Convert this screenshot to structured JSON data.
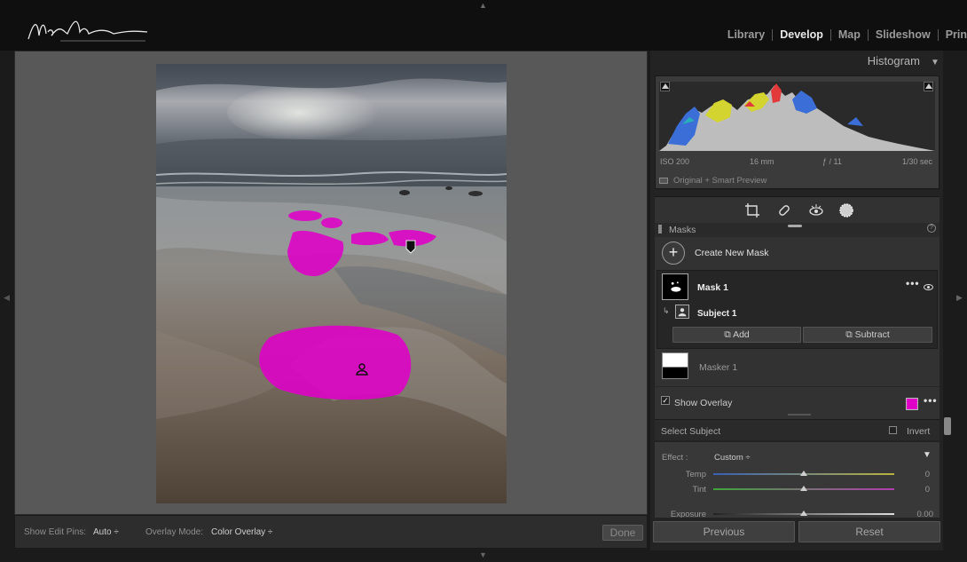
{
  "header": {
    "modules": [
      "Library",
      "Develop",
      "Map",
      "Slideshow",
      "Prin"
    ],
    "active_module": "Develop"
  },
  "canvas": {
    "toolbar": {
      "show_edit_pins_label": "Show Edit Pins:",
      "show_edit_pins_value": "Auto",
      "overlay_mode_label": "Overlay Mode:",
      "overlay_mode_value": "Color Overlay",
      "done_label": "Done"
    }
  },
  "histogram": {
    "title": "Histogram",
    "iso": "ISO 200",
    "focal": "16 mm",
    "aperture": "ƒ / 11",
    "shutter": "1/30 sec",
    "preview_label": "Original + Smart Preview"
  },
  "masks": {
    "section_title": "Masks",
    "create_new_label": "Create New Mask",
    "mask1_label": "Mask 1",
    "subject_label": "Subject 1",
    "add_label": "Add",
    "subtract_label": "Subtract",
    "masker_label": "Masker 1",
    "show_overlay_label": "Show Overlay",
    "overlay_color": "#e000c8",
    "select_subject_label": "Select Subject",
    "invert_label": "Invert"
  },
  "effect": {
    "label": "Effect :",
    "preset": "Custom",
    "sliders": [
      {
        "label": "Temp",
        "value": "0"
      },
      {
        "label": "Tint",
        "value": "0"
      },
      {
        "label": "Exposure",
        "value": "0.00"
      }
    ]
  },
  "footer": {
    "previous_label": "Previous",
    "reset_label": "Reset"
  }
}
